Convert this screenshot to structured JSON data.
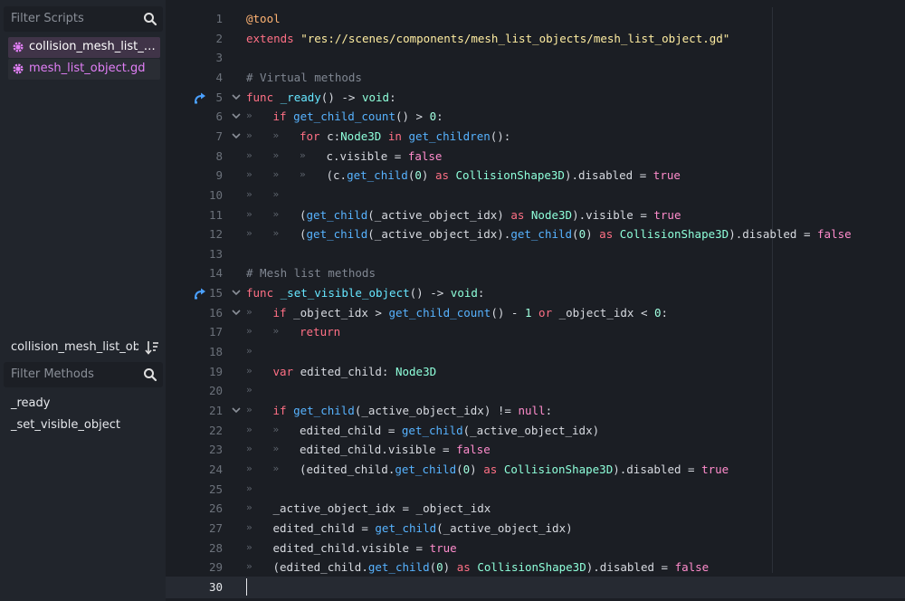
{
  "left_panel": {
    "filter_scripts_placeholder": "Filter Scripts",
    "scripts": [
      {
        "name": "collision_mesh_list_object.gd",
        "selected": true
      },
      {
        "name": "mesh_list_object.gd",
        "selected": false
      }
    ],
    "current_file": "collision_mesh_list_object",
    "filter_methods_placeholder": "Filter Methods",
    "methods": [
      "_ready",
      "_set_visible_object"
    ]
  },
  "editor": {
    "current_line": 30,
    "lines": [
      {
        "n": "1",
        "indent": 0,
        "fold": false,
        "override": false,
        "tabs": "",
        "html": "<span class='ann'>@tool</span>"
      },
      {
        "n": "2",
        "indent": 0,
        "fold": false,
        "override": false,
        "tabs": "",
        "html": "<span class='k'>extends</span> <span class='str'>\"res://scenes/components/mesh_list_objects/mesh_list_object.gd\"</span>"
      },
      {
        "n": "3",
        "indent": 0,
        "fold": false,
        "override": false,
        "tabs": "",
        "html": ""
      },
      {
        "n": "4",
        "indent": 0,
        "fold": false,
        "override": false,
        "tabs": "",
        "html": "<span class='com'># Virtual methods</span>"
      },
      {
        "n": "5",
        "indent": 0,
        "fold": true,
        "override": true,
        "tabs": "",
        "html": "<span class='k'>func</span> <span class='fnd'>_ready</span>() -&gt; <span class='ty'>void</span>:"
      },
      {
        "n": "6",
        "indent": 1,
        "fold": true,
        "override": false,
        "tabs": "»",
        "html": "<span class='k'>if</span> <span class='fn'>get_child_count</span>() &gt; <span class='num-l'>0</span>:"
      },
      {
        "n": "7",
        "indent": 2,
        "fold": true,
        "override": false,
        "tabs": "»   »",
        "html": "<span class='k'>for</span> c:<span class='ty'>Node3D</span> <span class='k'>in</span> <span class='fn'>get_children</span>():"
      },
      {
        "n": "8",
        "indent": 3,
        "fold": false,
        "override": false,
        "tabs": "»   »   »",
        "html": "c.visible = <span class='kc'>false</span>"
      },
      {
        "n": "9",
        "indent": 3,
        "fold": false,
        "override": false,
        "tabs": "»   »   »",
        "html": "(c.<span class='fn'>get_child</span>(<span class='num-l'>0</span>) <span class='k'>as</span> <span class='ty'>CollisionShape3D</span>).disabled = <span class='kc'>true</span>"
      },
      {
        "n": "10",
        "indent": 2,
        "fold": false,
        "override": false,
        "tabs": "»   »",
        "html": ""
      },
      {
        "n": "11",
        "indent": 2,
        "fold": false,
        "override": false,
        "tabs": "»   »",
        "html": "(<span class='fn'>get_child</span>(_active_object_idx) <span class='k'>as</span> <span class='ty'>Node3D</span>).visible = <span class='kc'>true</span>"
      },
      {
        "n": "12",
        "indent": 2,
        "fold": false,
        "override": false,
        "tabs": "»   »",
        "html": "(<span class='fn'>get_child</span>(_active_object_idx).<span class='fn'>get_child</span>(<span class='num-l'>0</span>) <span class='k'>as</span> <span class='ty'>CollisionShape3D</span>).disabled = <span class='kc'>false</span>"
      },
      {
        "n": "13",
        "indent": 0,
        "fold": false,
        "override": false,
        "tabs": "",
        "html": ""
      },
      {
        "n": "14",
        "indent": 0,
        "fold": false,
        "override": false,
        "tabs": "",
        "html": "<span class='com'># Mesh list methods</span>"
      },
      {
        "n": "15",
        "indent": 0,
        "fold": true,
        "override": true,
        "tabs": "",
        "html": "<span class='k'>func</span> <span class='fnd'>_set_visible_object</span>() -&gt; <span class='ty'>void</span>:"
      },
      {
        "n": "16",
        "indent": 1,
        "fold": true,
        "override": false,
        "tabs": "»",
        "html": "<span class='k'>if</span> _object_idx &gt; <span class='fn'>get_child_count</span>() - <span class='num-l'>1</span> <span class='k'>or</span> _object_idx &lt; <span class='num-l'>0</span>:"
      },
      {
        "n": "17",
        "indent": 2,
        "fold": false,
        "override": false,
        "tabs": "»   »",
        "html": "<span class='k'>return</span>"
      },
      {
        "n": "18",
        "indent": 1,
        "fold": false,
        "override": false,
        "tabs": "»",
        "html": ""
      },
      {
        "n": "19",
        "indent": 1,
        "fold": false,
        "override": false,
        "tabs": "»",
        "html": "<span class='k'>var</span> edited_child: <span class='ty'>Node3D</span>"
      },
      {
        "n": "20",
        "indent": 1,
        "fold": false,
        "override": false,
        "tabs": "»",
        "html": ""
      },
      {
        "n": "21",
        "indent": 1,
        "fold": true,
        "override": false,
        "tabs": "»",
        "html": "<span class='k'>if</span> <span class='fn'>get_child</span>(_active_object_idx) != <span class='kc'>null</span>:"
      },
      {
        "n": "22",
        "indent": 2,
        "fold": false,
        "override": false,
        "tabs": "»   »",
        "html": "edited_child = <span class='fn'>get_child</span>(_active_object_idx)"
      },
      {
        "n": "23",
        "indent": 2,
        "fold": false,
        "override": false,
        "tabs": "»   »",
        "html": "edited_child.visible = <span class='kc'>false</span>"
      },
      {
        "n": "24",
        "indent": 2,
        "fold": false,
        "override": false,
        "tabs": "»   »",
        "html": "(edited_child.<span class='fn'>get_child</span>(<span class='num-l'>0</span>) <span class='k'>as</span> <span class='ty'>CollisionShape3D</span>).disabled = <span class='kc'>true</span>"
      },
      {
        "n": "25",
        "indent": 1,
        "fold": false,
        "override": false,
        "tabs": "»",
        "html": ""
      },
      {
        "n": "26",
        "indent": 1,
        "fold": false,
        "override": false,
        "tabs": "»",
        "html": "_active_object_idx = _object_idx"
      },
      {
        "n": "27",
        "indent": 1,
        "fold": false,
        "override": false,
        "tabs": "»",
        "html": "edited_child = <span class='fn'>get_child</span>(_active_object_idx)"
      },
      {
        "n": "28",
        "indent": 1,
        "fold": false,
        "override": false,
        "tabs": "»",
        "html": "edited_child.visible = <span class='kc'>true</span>"
      },
      {
        "n": "29",
        "indent": 1,
        "fold": false,
        "override": false,
        "tabs": "»",
        "html": "(edited_child.<span class='fn'>get_child</span>(<span class='num-l'>0</span>) <span class='k'>as</span> <span class='ty'>CollisionShape3D</span>).disabled = <span class='kc'>false</span>"
      },
      {
        "n": "30",
        "indent": 0,
        "fold": false,
        "override": false,
        "tabs": "",
        "html": ""
      }
    ]
  }
}
